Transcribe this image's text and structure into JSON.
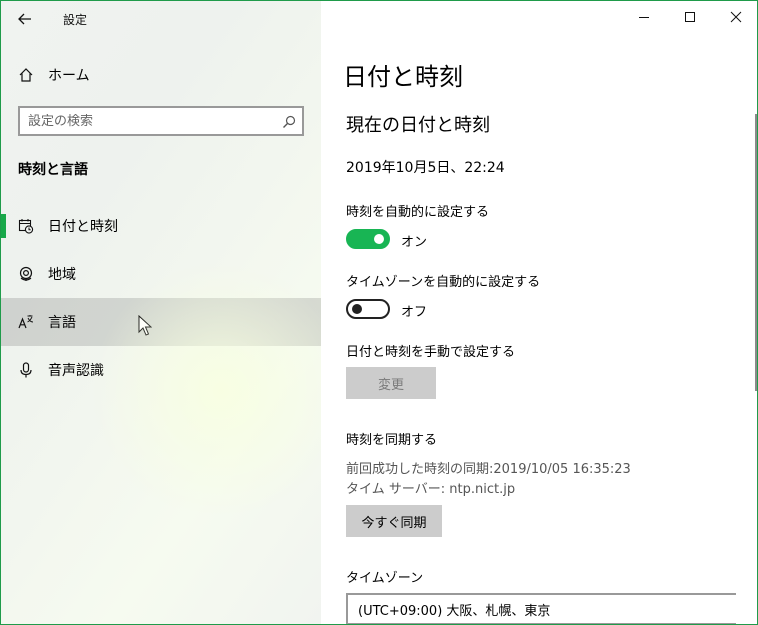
{
  "window": {
    "title": "設定",
    "accent_color": "#18a849"
  },
  "sidebar": {
    "home_label": "ホーム",
    "search_placeholder": "設定の検索",
    "section_title": "時刻と言語",
    "items": [
      {
        "label": "日付と時刻",
        "icon": "calendar-clock-icon",
        "selected": true
      },
      {
        "label": "地域",
        "icon": "globe-icon",
        "selected": false
      },
      {
        "label": "言語",
        "icon": "language-icon",
        "selected": false,
        "hovered": true
      },
      {
        "label": "音声認識",
        "icon": "microphone-icon",
        "selected": false
      }
    ]
  },
  "main": {
    "page_title": "日付と時刻",
    "current_section_title": "現在の日付と時刻",
    "current_datetime": "2019年10月5日、22:24",
    "auto_time": {
      "label": "時刻を自動的に設定する",
      "state_label": "オン",
      "on": true
    },
    "auto_timezone": {
      "label": "タイムゾーンを自動的に設定する",
      "state_label": "オフ",
      "on": false
    },
    "manual": {
      "label": "日付と時刻を手動で設定する",
      "button_label": "変更"
    },
    "sync": {
      "label": "時刻を同期する",
      "last_sync": "前回成功した時刻の同期:2019/10/05 16:35:23",
      "time_server": "タイム サーバー: ntp.nict.jp",
      "button_label": "今すぐ同期"
    },
    "timezone": {
      "label": "タイムゾーン",
      "value": "(UTC+09:00) 大阪、札幌、東京"
    }
  }
}
